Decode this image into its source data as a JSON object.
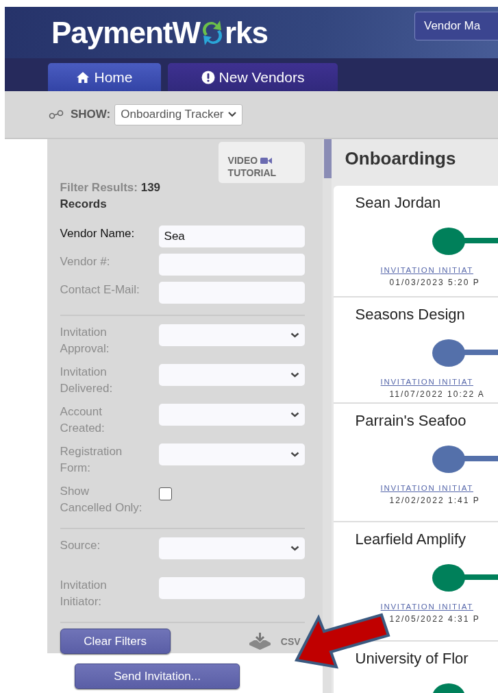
{
  "header": {
    "logo": {
      "before": "PaymentW",
      "after": "rks"
    },
    "button": "Vendor Ma"
  },
  "nav": {
    "tabs": [
      {
        "label": "Home",
        "selected": true
      },
      {
        "label": "New Vendors",
        "selected": false
      }
    ]
  },
  "show": {
    "label": "SHOW:",
    "value": "Onboarding Tracker"
  },
  "filters": {
    "video_button": [
      "VIDEO",
      "TUTORIAL"
    ],
    "results_label": "Filter Results:",
    "results_count": "139",
    "results_unit": "Records",
    "groups": [
      [
        {
          "kind": "text",
          "label": "Vendor Name:",
          "value": "Sea"
        },
        {
          "kind": "text",
          "label": "Vendor #:"
        },
        {
          "kind": "text",
          "label": "Contact E-Mail:"
        }
      ],
      [
        {
          "kind": "select",
          "label": "Invitation\nApproval:"
        },
        {
          "kind": "select",
          "label": "Invitation\nDelivered:"
        },
        {
          "kind": "select",
          "label": "Account\nCreated:"
        },
        {
          "kind": "select",
          "label": "Registration\nForm:"
        },
        {
          "kind": "checkbox",
          "label": "Show\nCancelled Only:",
          "checked": false
        }
      ],
      [
        {
          "kind": "select",
          "label": "Source:"
        },
        {
          "kind": "text",
          "label": "Invitation\nInitiator:"
        }
      ]
    ],
    "clear_button": "Clear Filters",
    "csv": "CSV"
  },
  "send_button": "Send Invitation...",
  "onboardings": {
    "title": "Onboardings",
    "cards": [
      {
        "name": "Sean Jordan",
        "color": "#00805a",
        "status": "INVITATION INITIAT",
        "date": "01/03/2023 5:20 P"
      },
      {
        "name": "Seasons Design",
        "color": "#5470aa",
        "status": "INVITATION INITIAT",
        "date": "11/07/2022 10:22 A"
      },
      {
        "name": "Parrain's Seafoo",
        "color": "#5470aa",
        "status": "INVITATION INITIAT",
        "date": "12/02/2022 1:41 P"
      },
      {
        "name": "Learfield Amplify",
        "color": "#00805a",
        "status": "INVITATION INITIAT",
        "date": "12/05/2022 4:31 P"
      },
      {
        "name": "University of Flor",
        "color": "#00805a"
      }
    ]
  }
}
